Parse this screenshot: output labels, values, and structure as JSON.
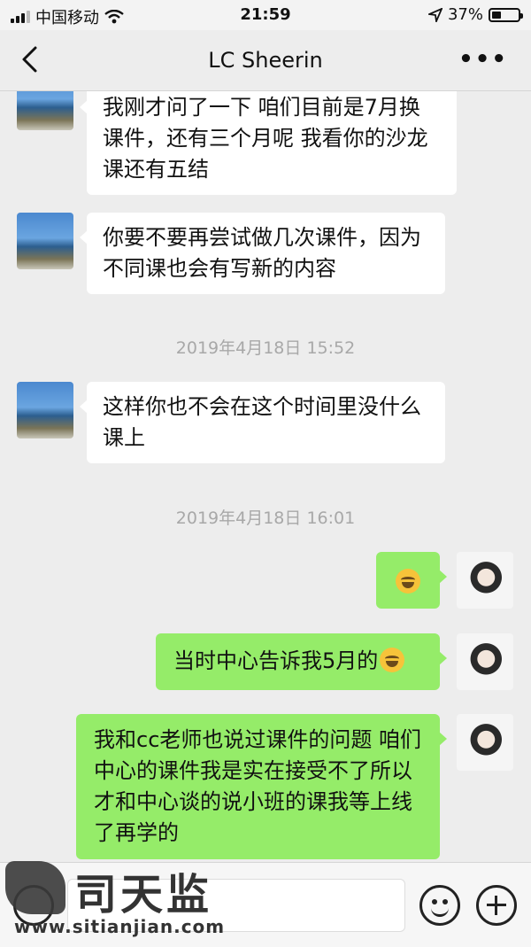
{
  "status_bar": {
    "carrier": "中国移动",
    "time": "21:59",
    "battery_text": "37%",
    "battery_level": 0.37
  },
  "nav": {
    "title": "LC Sheerin",
    "more": "•••"
  },
  "messages": [
    {
      "side": "left",
      "text": "我刚才问了一下 咱们目前是7月换课件，还有三个月呢 我看你的沙龙课还有五结"
    },
    {
      "side": "left",
      "text": "你要不要再尝试做几次课件，因为不同课也会有写新的内容"
    },
    {
      "timestamp": "2019年4月18日 15:52"
    },
    {
      "side": "left",
      "text": "这样你也不会在这个时间里没什么课上"
    },
    {
      "timestamp": "2019年4月18日 16:01"
    },
    {
      "side": "right",
      "emoji": "laugh-cry-emoji"
    },
    {
      "side": "right",
      "text": "当时中心告诉我5月的",
      "emoji": "laugh-cry-emoji"
    },
    {
      "side": "right",
      "text": "我和cc老师也说过课件的问题 咱们中心的课件我是实在接受不了所以才和中心谈的说小班的课我等上线了再学的"
    }
  ],
  "watermark": {
    "name": "司天监",
    "url": "www.sitianjian.com"
  },
  "colors": {
    "background": "#ededed",
    "bubble_left": "#ffffff",
    "bubble_right": "#95ec69",
    "timestamp": "#a8a8a8"
  }
}
